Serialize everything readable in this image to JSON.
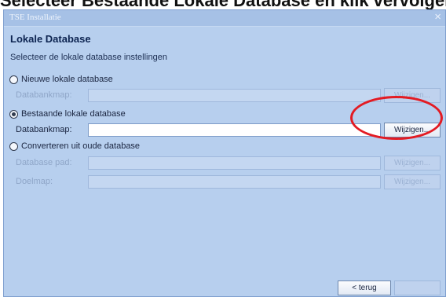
{
  "top_caption": "Selecteer Bestaande Lokale Database en klik vervolgens op Wijzigen",
  "window": {
    "title": "TSE Installatie",
    "close_glyph": "×"
  },
  "page": {
    "heading": "Lokale Database",
    "subheading": "Selecteer de lokale database instellingen"
  },
  "options": {
    "new_db": {
      "label": "Nieuwe lokale database",
      "selected": false,
      "field_label": "Databankmap:",
      "field_value": "",
      "button_label": "Wijzigen..."
    },
    "existing_db": {
      "label": "Bestaande lokale database",
      "selected": true,
      "field_label": "Databankmap:",
      "field_value": "",
      "button_label": "Wijzigen..."
    },
    "convert_db": {
      "label": "Converteren uit oude database",
      "selected": false,
      "db_path_label": "Database pad:",
      "db_path_value": "",
      "target_label": "Doelmap:",
      "target_value": "",
      "db_path_button": "Wijzigen...",
      "target_button": "Wijzigen..."
    }
  },
  "footer": {
    "back_label": "< terug",
    "next_label": ""
  },
  "colors": {
    "highlight": "#e31b23",
    "window_bg": "#b7cfee"
  }
}
